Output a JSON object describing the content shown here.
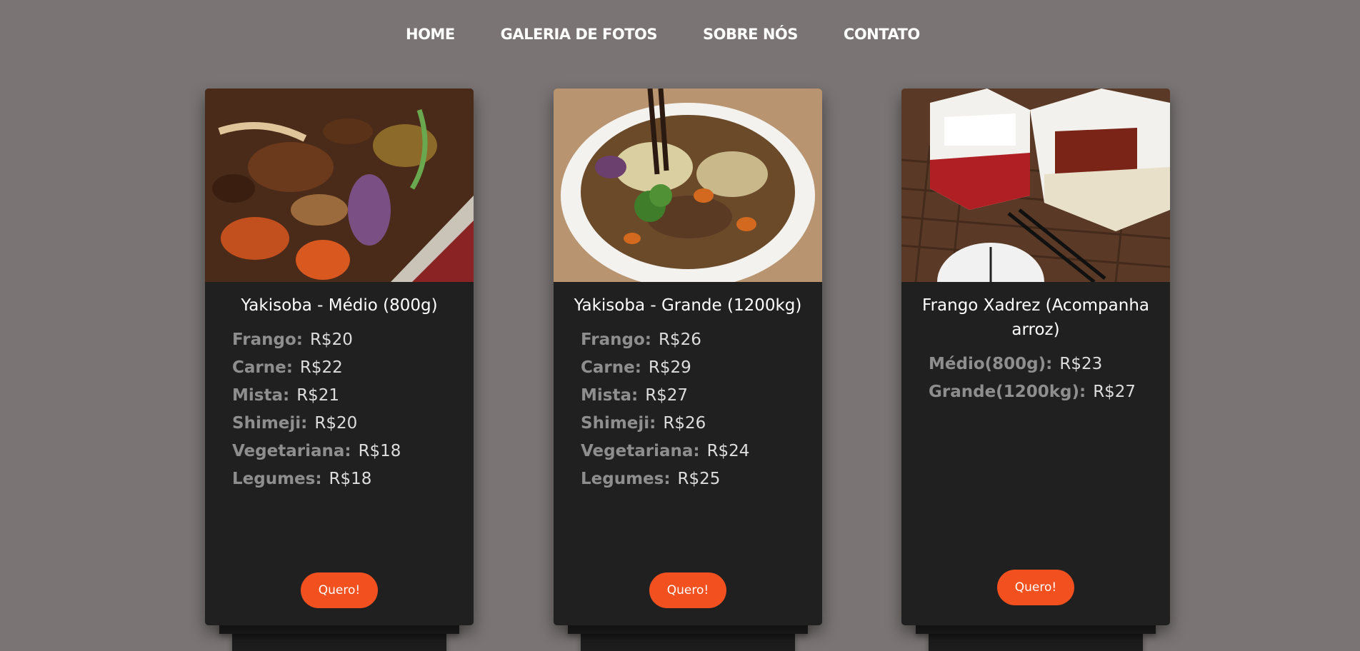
{
  "nav": {
    "items": [
      "HOME",
      "GALERIA DE FOTOS",
      "SOBRE NÓS",
      "CONTATO"
    ]
  },
  "colors": {
    "background": "#7a7574",
    "card": "#202020",
    "button": "#f2511f"
  },
  "cards": [
    {
      "title": "Yakisoba - Médio (800g)",
      "image": "stir-fried vegetables and meat in sauce, close-up",
      "prices": [
        {
          "label": "Frango:",
          "value": "R$20"
        },
        {
          "label": "Carne:",
          "value": "R$22"
        },
        {
          "label": "Mista:",
          "value": "R$21"
        },
        {
          "label": "Shimeji:",
          "value": "R$20"
        },
        {
          "label": "Vegetariana:",
          "value": "R$18"
        },
        {
          "label": "Legumes:",
          "value": "R$18"
        }
      ],
      "button": "Quero!"
    },
    {
      "title": "Yakisoba - Grande (1200kg)",
      "image": "plate of yakisoba with broccoli and chopsticks",
      "prices": [
        {
          "label": "Frango:",
          "value": "R$26"
        },
        {
          "label": "Carne:",
          "value": "R$29"
        },
        {
          "label": "Mista:",
          "value": "R$27"
        },
        {
          "label": "Shimeji:",
          "value": "R$26"
        },
        {
          "label": "Vegetariana:",
          "value": "R$24"
        },
        {
          "label": "Legumes:",
          "value": "R$25"
        }
      ],
      "button": "Quero!"
    },
    {
      "title": "Frango Xadrez (Acompanha arroz)",
      "image": "takeout boxes with rice and chicken on woven placemat",
      "prices": [
        {
          "label": "Médio(800g):",
          "value": "R$23"
        },
        {
          "label": "Grande(1200kg):",
          "value": "R$27"
        }
      ],
      "button": "Quero!"
    }
  ]
}
